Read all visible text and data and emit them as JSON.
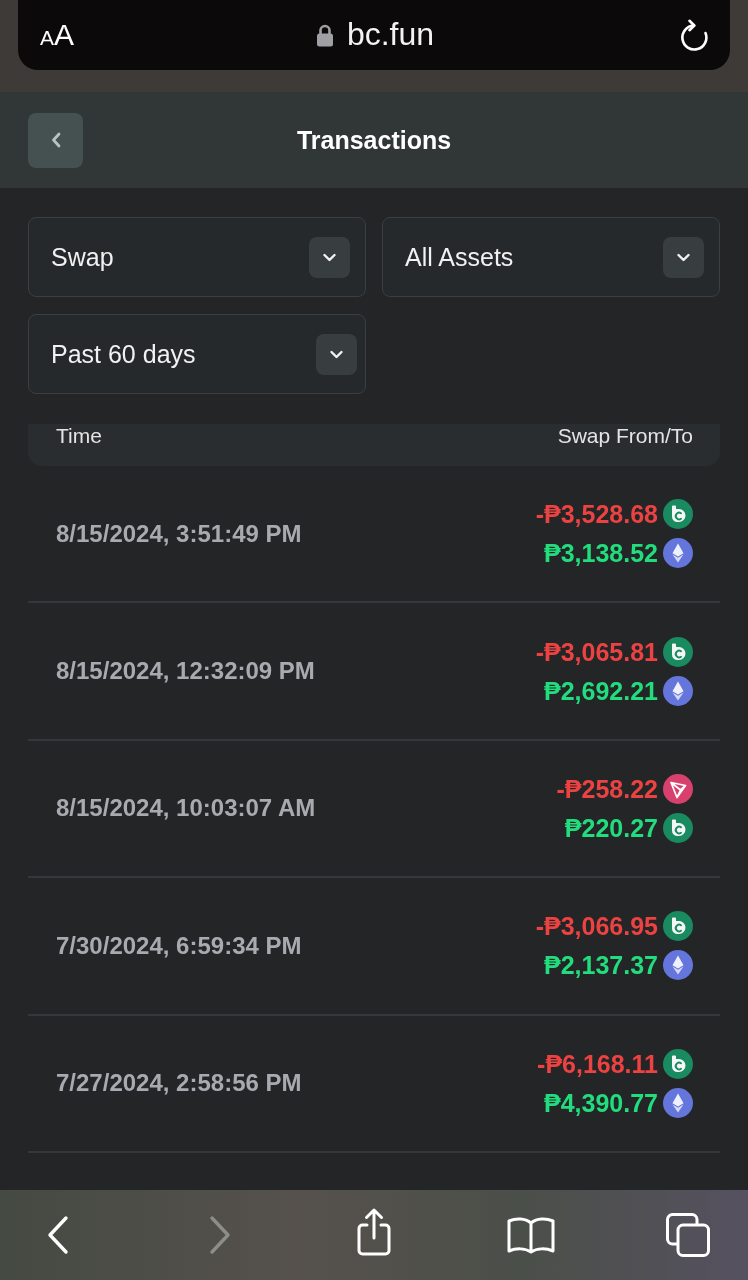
{
  "browser": {
    "text_size_label": "AA",
    "url": "bc.fun"
  },
  "header": {
    "title": "Transactions"
  },
  "filters": [
    {
      "value": "Swap"
    },
    {
      "value": "All Assets"
    },
    {
      "value": "Past 60 days"
    }
  ],
  "table": {
    "columns": [
      "Time",
      "Swap From/To"
    ],
    "rows": [
      {
        "time": "8/15/2024, 3:51:49 PM",
        "from": {
          "amount": "-₱3,528.68",
          "kind": "bc"
        },
        "to": {
          "amount": "₱3,138.52",
          "kind": "eth"
        }
      },
      {
        "time": "8/15/2024, 12:32:09 PM",
        "from": {
          "amount": "-₱3,065.81",
          "kind": "bc"
        },
        "to": {
          "amount": "₱2,692.21",
          "kind": "eth"
        }
      },
      {
        "time": "8/15/2024, 10:03:07 AM",
        "from": {
          "amount": "-₱258.22",
          "kind": "tron"
        },
        "to": {
          "amount": "₱220.27",
          "kind": "bc"
        }
      },
      {
        "time": "7/30/2024, 6:59:34 PM",
        "from": {
          "amount": "-₱3,066.95",
          "kind": "bc"
        },
        "to": {
          "amount": "₱2,137.37",
          "kind": "eth"
        }
      },
      {
        "time": "7/27/2024, 2:58:56 PM",
        "from": {
          "amount": "-₱6,168.11",
          "kind": "bc"
        },
        "to": {
          "amount": "₱4,390.77",
          "kind": "eth"
        }
      }
    ]
  },
  "toolbar": {
    "back_disabled": false,
    "forward_disabled": true
  }
}
